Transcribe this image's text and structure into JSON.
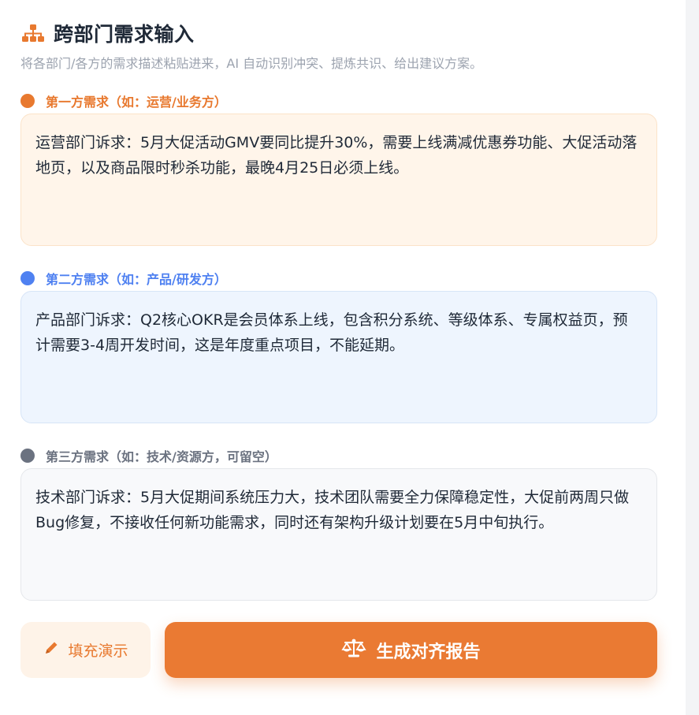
{
  "header": {
    "icon": "sitemap-icon",
    "title": "跨部门需求输入",
    "subtitle": "将各部门/各方的需求描述粘贴进来，AI 自动识别冲突、提炼共识、给出建议方案。"
  },
  "parties": [
    {
      "label": "第一方需求（如：运营/业务方）",
      "color": "#e8792f",
      "value": "运营部门诉求：5月大促活动GMV要同比提升30%，需要上线满减优惠券功能、大促活动落地页，以及商品限时秒杀功能，最晚4月25日必须上线。"
    },
    {
      "label": "第二方需求（如：产品/研发方）",
      "color": "#4f81f1",
      "value": "产品部门诉求：Q2核心OKR是会员体系上线，包含积分系统、等级体系、专属权益页，预计需要3-4周开发时间，这是年度重点项目，不能延期。"
    },
    {
      "label": "第三方需求（如：技术/资源方，可留空）",
      "color": "#6b7280",
      "value": "技术部门诉求：5月大促期间系统压力大，技术团队需要全力保障稳定性，大促前两周只做Bug修复，不接收任何新功能需求，同时还有架构升级计划要在5月中旬执行。"
    }
  ],
  "actions": {
    "demo_label": "填充演示",
    "demo_icon": "pencil-icon",
    "generate_label": "生成对齐报告",
    "generate_icon": "scale-icon",
    "accent": "#ea7a33"
  }
}
